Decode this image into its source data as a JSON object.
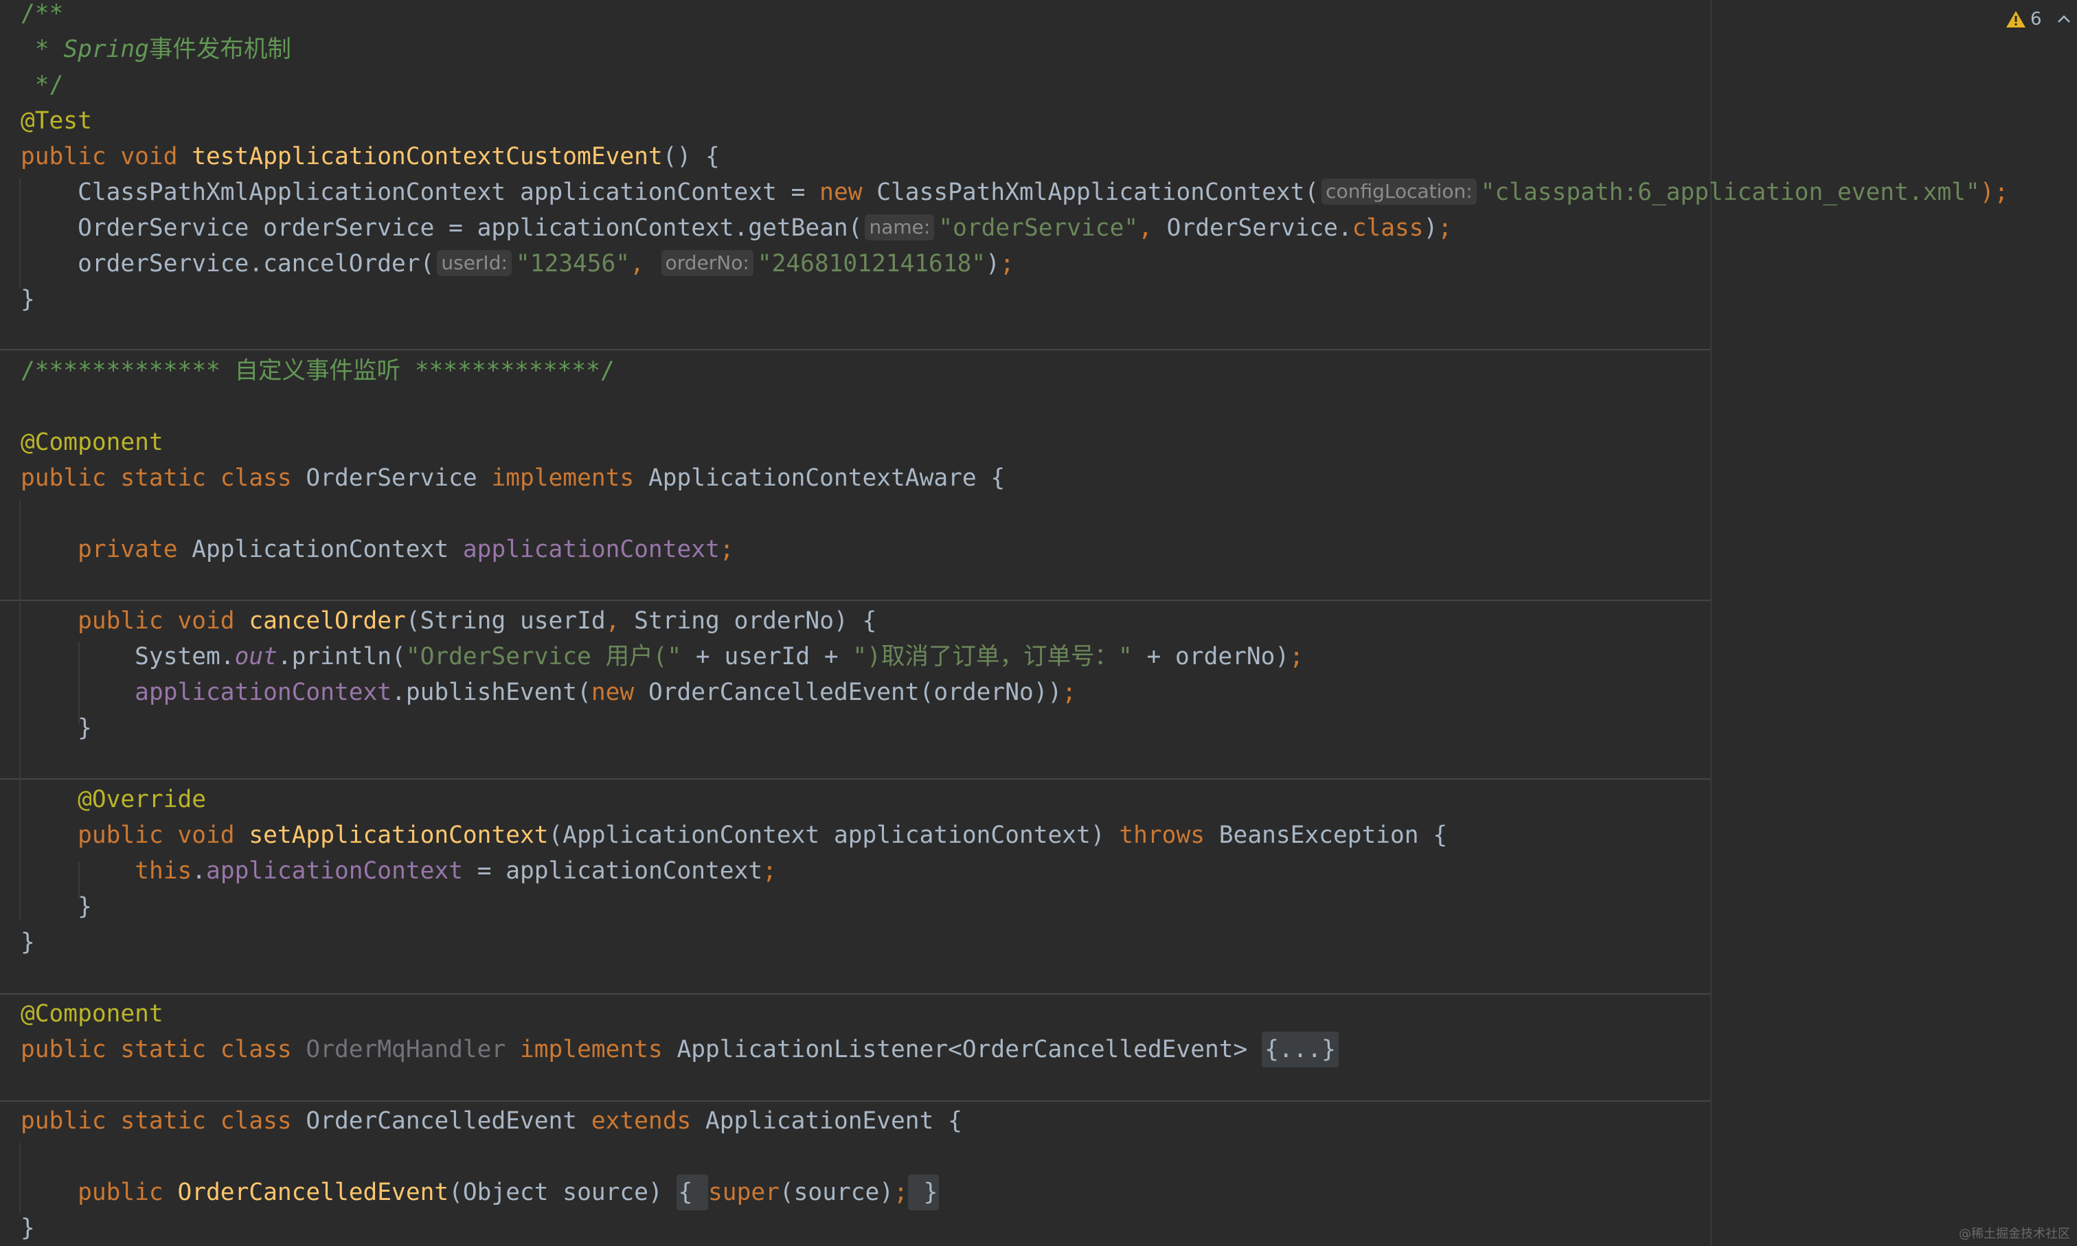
{
  "inspection": {
    "warning_count": "6",
    "warning_icon": "warning-triangle-icon",
    "collapse_icon": "chevron-up-icon"
  },
  "watermark": "@稀土掘金技术社区",
  "colors": {
    "background": "#2b2b2b",
    "keyword": "#cc7832",
    "string": "#6a8759",
    "comment": "#629755",
    "annotation": "#bbb529",
    "method": "#ffc66d",
    "field": "#9876aa",
    "plain": "#a9b7c6"
  },
  "code_lines": [
    [
      {
        "t": "/**",
        "c": "cm"
      }
    ],
    [
      {
        "t": " * ",
        "c": "cm"
      },
      {
        "t": "Spring",
        "c": "cmi"
      },
      {
        "t": "事件发布机制",
        "c": "cm"
      }
    ],
    [
      {
        "t": " */",
        "c": "cm"
      }
    ],
    [
      {
        "t": "@Test",
        "c": "an"
      }
    ],
    [
      {
        "t": "public void ",
        "c": "kw"
      },
      {
        "t": "testApplicationContextCustomEvent",
        "c": "fn"
      },
      {
        "t": "() {",
        "c": "pl"
      }
    ],
    [
      {
        "t": "    ClassPathXmlApplicationContext applicationContext = ",
        "c": "pl"
      },
      {
        "t": "new ",
        "c": "kw"
      },
      {
        "t": "ClassPathXmlApplicationContext(",
        "c": "pl"
      },
      {
        "t": "configLocation:",
        "c": "hint"
      },
      {
        "t": "\"classpath:6_application_event.xml\"",
        "c": "str"
      },
      {
        "t": ");",
        "c": "kw"
      }
    ],
    [
      {
        "t": "    OrderService orderService = applicationContext.getBean(",
        "c": "pl"
      },
      {
        "t": "name:",
        "c": "hint"
      },
      {
        "t": "\"orderService\"",
        "c": "str"
      },
      {
        "t": ", ",
        "c": "kw"
      },
      {
        "t": "OrderService.",
        "c": "pl"
      },
      {
        "t": "class",
        "c": "kw"
      },
      {
        "t": ")",
        "c": "pl"
      },
      {
        "t": ";",
        "c": "kw"
      }
    ],
    [
      {
        "t": "    orderService.cancelOrder(",
        "c": "pl"
      },
      {
        "t": "userId:",
        "c": "hint"
      },
      {
        "t": "\"123456\"",
        "c": "str"
      },
      {
        "t": ", ",
        "c": "kw"
      },
      {
        "t": "orderNo:",
        "c": "hint"
      },
      {
        "t": "\"24681012141618\"",
        "c": "str"
      },
      {
        "t": ")",
        "c": "pl"
      },
      {
        "t": ";",
        "c": "kw"
      }
    ],
    [
      {
        "t": "}",
        "c": "pl"
      }
    ],
    [],
    [
      {
        "t": "/************* 自定义事件监听 *************/",
        "c": "cm"
      }
    ],
    [],
    [
      {
        "t": "@Component",
        "c": "an"
      }
    ],
    [
      {
        "t": "public static class ",
        "c": "kw"
      },
      {
        "t": "OrderService ",
        "c": "pl"
      },
      {
        "t": "implements ",
        "c": "kw"
      },
      {
        "t": "ApplicationContextAware {",
        "c": "pl"
      }
    ],
    [],
    [
      {
        "t": "    private ",
        "c": "kw"
      },
      {
        "t": "ApplicationContext ",
        "c": "pl"
      },
      {
        "t": "applicationContext",
        "c": "fld"
      },
      {
        "t": ";",
        "c": "kw"
      }
    ],
    [],
    [
      {
        "t": "    public void ",
        "c": "kw"
      },
      {
        "t": "cancelOrder",
        "c": "fn"
      },
      {
        "t": "(String userId",
        "c": "pl"
      },
      {
        "t": ", ",
        "c": "kw"
      },
      {
        "t": "String orderNo) {",
        "c": "pl"
      }
    ],
    [
      {
        "t": "        System.",
        "c": "pl"
      },
      {
        "t": "out",
        "c": "st"
      },
      {
        "t": ".println(",
        "c": "pl"
      },
      {
        "t": "\"OrderService 用户(\"",
        "c": "str"
      },
      {
        "t": " + userId + ",
        "c": "pl"
      },
      {
        "t": "\")取消了订单，订单号：\"",
        "c": "str"
      },
      {
        "t": " + orderNo)",
        "c": "pl"
      },
      {
        "t": ";",
        "c": "kw"
      }
    ],
    [
      {
        "t": "        ",
        "c": "pl"
      },
      {
        "t": "applicationContext",
        "c": "fld"
      },
      {
        "t": ".publishEvent(",
        "c": "pl"
      },
      {
        "t": "new ",
        "c": "kw"
      },
      {
        "t": "OrderCancelledEvent(orderNo))",
        "c": "pl"
      },
      {
        "t": ";",
        "c": "kw"
      }
    ],
    [
      {
        "t": "    }",
        "c": "pl"
      }
    ],
    [],
    [
      {
        "t": "    @Override",
        "c": "an"
      }
    ],
    [
      {
        "t": "    public void ",
        "c": "kw"
      },
      {
        "t": "setApplicationContext",
        "c": "fn"
      },
      {
        "t": "(ApplicationContext applicationContext) ",
        "c": "pl"
      },
      {
        "t": "throws ",
        "c": "kw"
      },
      {
        "t": "BeansException {",
        "c": "pl"
      }
    ],
    [
      {
        "t": "        ",
        "c": "pl"
      },
      {
        "t": "this",
        "c": "kw"
      },
      {
        "t": ".",
        "c": "pl"
      },
      {
        "t": "applicationContext",
        "c": "fld"
      },
      {
        "t": " = applicationContext",
        "c": "pl"
      },
      {
        "t": ";",
        "c": "kw"
      }
    ],
    [
      {
        "t": "    }",
        "c": "pl"
      }
    ],
    [
      {
        "t": "}",
        "c": "pl"
      }
    ],
    [],
    [
      {
        "t": "@Component",
        "c": "an"
      }
    ],
    [
      {
        "t": "public static class ",
        "c": "kw"
      },
      {
        "t": "OrderMqHandler ",
        "c": "unused"
      },
      {
        "t": "implements ",
        "c": "kw"
      },
      {
        "t": "ApplicationListener<OrderCancelledEvent> ",
        "c": "pl"
      },
      {
        "t": "{...}",
        "c": "fold"
      }
    ],
    [],
    [
      {
        "t": "public static class ",
        "c": "kw"
      },
      {
        "t": "OrderCancelledEvent ",
        "c": "pl"
      },
      {
        "t": "extends ",
        "c": "kw"
      },
      {
        "t": "ApplicationEvent {",
        "c": "pl"
      }
    ],
    [],
    [
      {
        "t": "    public ",
        "c": "kw"
      },
      {
        "t": "OrderCancelledEvent",
        "c": "fn"
      },
      {
        "t": "(Object source) ",
        "c": "pl"
      },
      {
        "t": "{ ",
        "c": "fold sm"
      },
      {
        "t": "super",
        "c": "kw"
      },
      {
        "t": "(source)",
        "c": "pl"
      },
      {
        "t": ";",
        "c": "kw"
      },
      {
        "t": " }",
        "c": "fold sm"
      }
    ],
    [
      {
        "t": "}",
        "c": "pl"
      }
    ]
  ]
}
